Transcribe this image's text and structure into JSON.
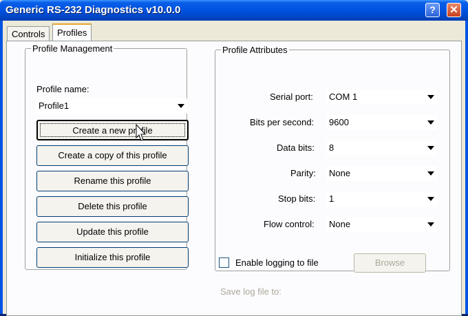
{
  "window": {
    "title": "Generic RS-232 Diagnostics v10.0.0"
  },
  "tabs": [
    {
      "label": "Controls"
    },
    {
      "label": "Profiles"
    }
  ],
  "profile_management": {
    "legend": "Profile Management",
    "name_label": "Profile name:",
    "name_value": "Profile1",
    "buttons": [
      {
        "label": "Create a new profile"
      },
      {
        "label": "Create a copy of this profile"
      },
      {
        "label": "Rename this profile"
      },
      {
        "label": "Delete this profile"
      },
      {
        "label": "Update this profile"
      },
      {
        "label": "Initialize this profile"
      }
    ]
  },
  "profile_attributes": {
    "legend": "Profile Attributes",
    "fields": [
      {
        "label": "Serial port:",
        "value": "COM 1"
      },
      {
        "label": "Bits per second:",
        "value": "9600"
      },
      {
        "label": "Data bits:",
        "value": "8"
      },
      {
        "label": "Parity:",
        "value": "None"
      },
      {
        "label": "Stop bits:",
        "value": "1"
      },
      {
        "label": "Flow control:",
        "value": "None"
      }
    ],
    "logging_label": "Enable logging to file",
    "browse_label": "Browse",
    "save_log_label": "Save log file to:"
  },
  "colors": {
    "titlebar": "#0054e3",
    "face": "#ece9d8",
    "disabled_text": "#aca899"
  },
  "icons": {
    "help": "question-mark-icon",
    "close": "close-icon",
    "dropdown": "chevron-down-icon",
    "cursor": "mouse-pointer-icon"
  }
}
